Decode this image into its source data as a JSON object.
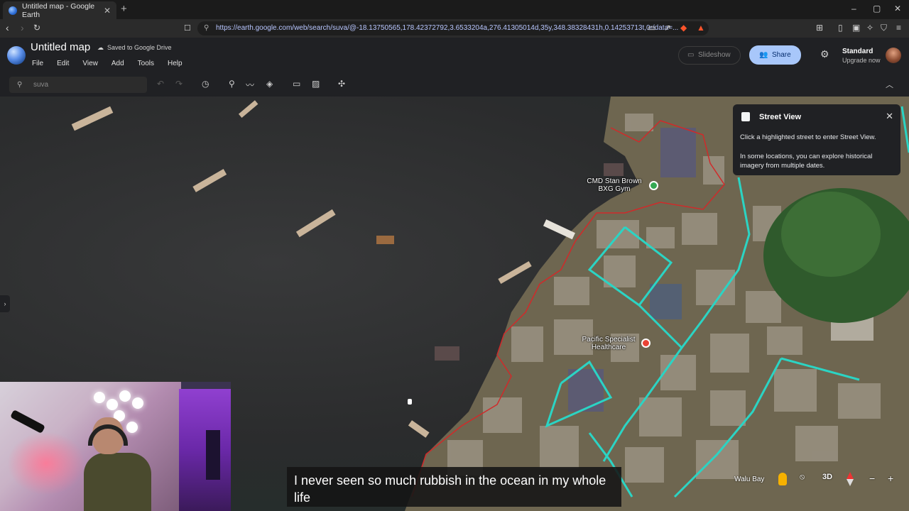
{
  "browser": {
    "tab_title": "Untitled map - Google Earth",
    "url": "https://earth.google.com/web/search/suva/@-18.13750565,178.42372792,3.6533204a,276.41305014d,35y,348.38328431h,0.14253713t,0r/data=..."
  },
  "app": {
    "title": "Untitled map",
    "saved_status": "Saved to Google Drive",
    "menus": [
      "File",
      "Edit",
      "View",
      "Add",
      "Tools",
      "Help"
    ],
    "slideshow_label": "Slideshow",
    "share_label": "Share",
    "plan_label": "Standard",
    "upgrade_label": "Upgrade now"
  },
  "toolbar": {
    "search_value": "suva",
    "icons": [
      "undo-icon",
      "redo-icon",
      "history-icon",
      "placemark-icon",
      "path-icon",
      "layers-icon",
      "ruler-icon",
      "add-image-icon",
      "satellite-icon"
    ]
  },
  "street_view": {
    "title": "Street View",
    "line1": "Click a highlighted street to enter Street View.",
    "line2": "In some locations, you can explore historical imagery from multiple dates."
  },
  "map_labels": {
    "gym": "CMD Stan Brown BXG Gym",
    "healthcare": "Pacific Specialist Healthcare",
    "bay": "Walu Bay"
  },
  "map_controls": {
    "view_mode": "3D"
  },
  "caption": "I never seen so much rubbish in the ocean in my whole life",
  "colors": {
    "street_view_lines": "#2bd4c4",
    "boundary_lines": "#d02a2a",
    "share_bg": "#a8c7fa",
    "gym_pin": "#34a853",
    "hospital_pin": "#ea4335"
  }
}
